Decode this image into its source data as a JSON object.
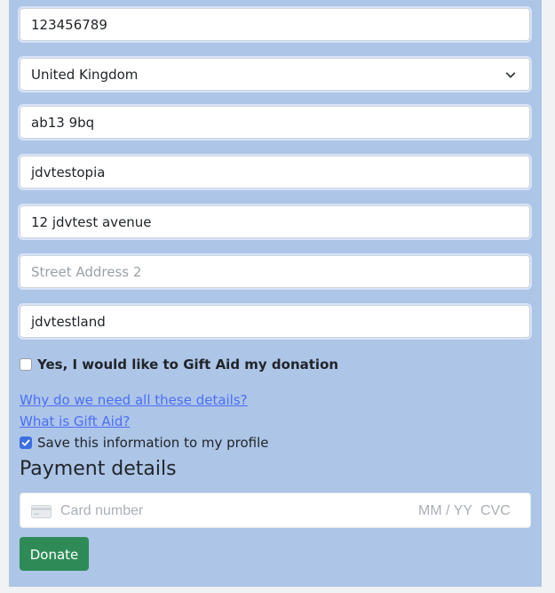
{
  "form": {
    "phone_value": "123456789",
    "country_selected": "United Kingdom",
    "postcode_value": "ab13 9bq",
    "city_value": "jdvtestopia",
    "address1_value": "12 jdvtest avenue",
    "address2_placeholder": "Street Address 2",
    "region_value": "jdvtestland"
  },
  "gift_aid": {
    "label": "Yes, I would like to Gift Aid my donation",
    "checked": false
  },
  "links": {
    "why_details": "Why do we need all these details?",
    "what_gift_aid": "What is Gift Aid?"
  },
  "save_profile": {
    "label": "Save this information to my profile",
    "checked": true
  },
  "payment": {
    "heading": "Payment details",
    "card_placeholder": "Card number",
    "expiry_placeholder": "MM / YY",
    "cvc_placeholder": "CVC"
  },
  "actions": {
    "donate_label": "Donate"
  },
  "colors": {
    "panel_bg": "#adc5e7",
    "link": "#4c6ef5",
    "donate_button": "#2e8b57",
    "checkbox_checked": "#3b6fe0"
  },
  "icons": {
    "select_chevron": "chevron-down-icon",
    "card": "credit-card-icon",
    "check": "check-icon"
  }
}
